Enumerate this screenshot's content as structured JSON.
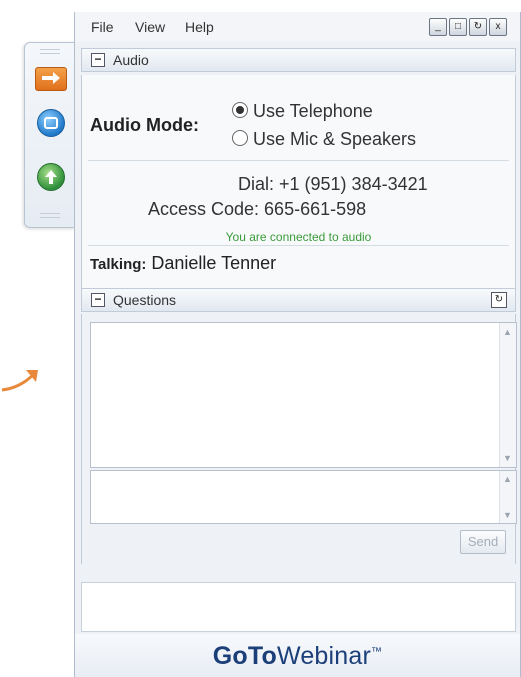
{
  "menu": {
    "file": "File",
    "view": "View",
    "help": "Help"
  },
  "window_controls": {
    "minimize": "_",
    "restore": "□",
    "undock": "↻",
    "close": "x"
  },
  "audio": {
    "title": "Audio",
    "mode_label": "Audio Mode:",
    "options": [
      {
        "label": "Use Telephone",
        "selected": true
      },
      {
        "label": "Use Mic & Speakers",
        "selected": false
      }
    ],
    "dial_label": "Dial: +1 (951) 384-3421",
    "access_code_label": "Access Code: 665-661-598",
    "connected_text": "You are connected to audio",
    "talking_label": "Talking:",
    "talking_name": "Danielle Tenner"
  },
  "questions": {
    "title": "Questions",
    "send_label": "Send"
  },
  "brand": {
    "go": "Go",
    "to": "To",
    "webinar": "Webinar",
    "tm": "™"
  },
  "sidebar": {
    "icons": [
      "arrow-right-icon",
      "stop-icon",
      "upload-icon"
    ]
  },
  "colors": {
    "accent_orange": "#e0701c",
    "connected_green": "#3a9b3a",
    "brand_blue": "#1b3f78"
  }
}
